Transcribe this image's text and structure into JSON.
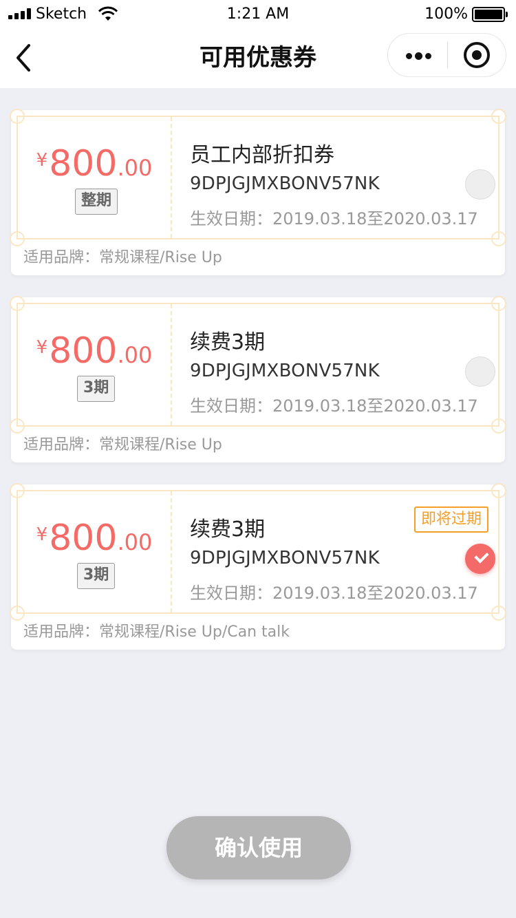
{
  "status_bar": {
    "carrier": "Sketch",
    "time": "1:21 AM",
    "battery_percent": "100%"
  },
  "nav": {
    "title": "可用优惠券",
    "back_icon": "chevron-left-icon",
    "more_icon": "more-dots-icon",
    "target_icon": "target-icon"
  },
  "coupons": [
    {
      "currency": "¥",
      "amount_int": "800",
      "amount_dec": ".00",
      "period_tag": "整期",
      "title": "员工内部折扣券",
      "code": "9DPJGJMXBONV57NK",
      "date_label": "生效日期：2019.03.18至2020.03.17",
      "brand_label": "适用品牌：常规课程/Rise Up",
      "selected": false,
      "expiring_label": ""
    },
    {
      "currency": "¥",
      "amount_int": "800",
      "amount_dec": ".00",
      "period_tag": "3期",
      "title": "续费3期",
      "code": "9DPJGJMXBONV57NK",
      "date_label": "生效日期：2019.03.18至2020.03.17",
      "brand_label": "适用品牌：常规课程/Rise Up",
      "selected": false,
      "expiring_label": ""
    },
    {
      "currency": "¥",
      "amount_int": "800",
      "amount_dec": ".00",
      "period_tag": "3期",
      "title": "续费3期",
      "code": "9DPJGJMXBONV57NK",
      "date_label": "生效日期：2019.03.18至2020.03.17",
      "brand_label": "适用品牌：常规课程/Rise Up/Can talk",
      "selected": true,
      "expiring_label": "即将过期"
    }
  ],
  "confirm_button": "确认使用",
  "colors": {
    "price": "#f26b67",
    "frame": "#fbe6c4",
    "expiring": "#f59f28",
    "selected": "#f46a68",
    "confirm_disabled": "#b5b5b5",
    "page_background": "#eeeff4"
  }
}
